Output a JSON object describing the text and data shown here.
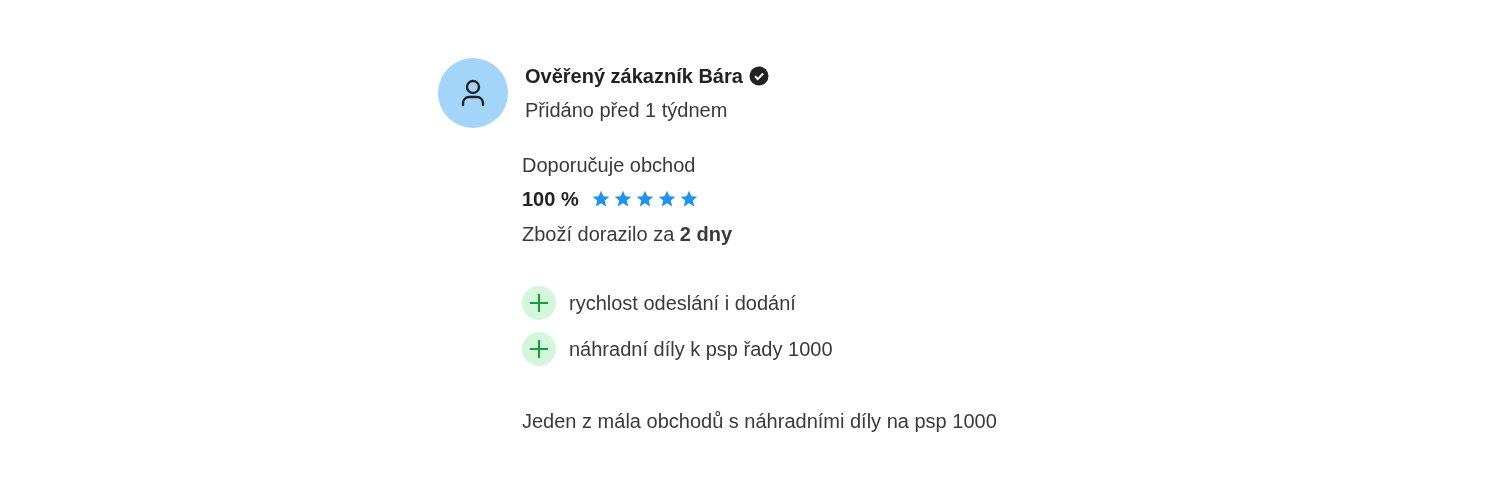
{
  "review": {
    "author": "Ověřený zákazník Bára",
    "verified": true,
    "added": "Přidáno před 1 týdnem",
    "recommend": "Doporučuje obchod",
    "percent": "100 %",
    "stars": 5,
    "delivery": "Zboží dorazilo za **2 dny**",
    "points": [
      {
        "kind": "pro",
        "text": "rychlost odeslání i dodání"
      },
      {
        "kind": "pro",
        "text": "náhradní díly k psp řady 1000"
      }
    ],
    "comment": "Jeden z mála obchodů s náhradními díly na psp 1000"
  }
}
